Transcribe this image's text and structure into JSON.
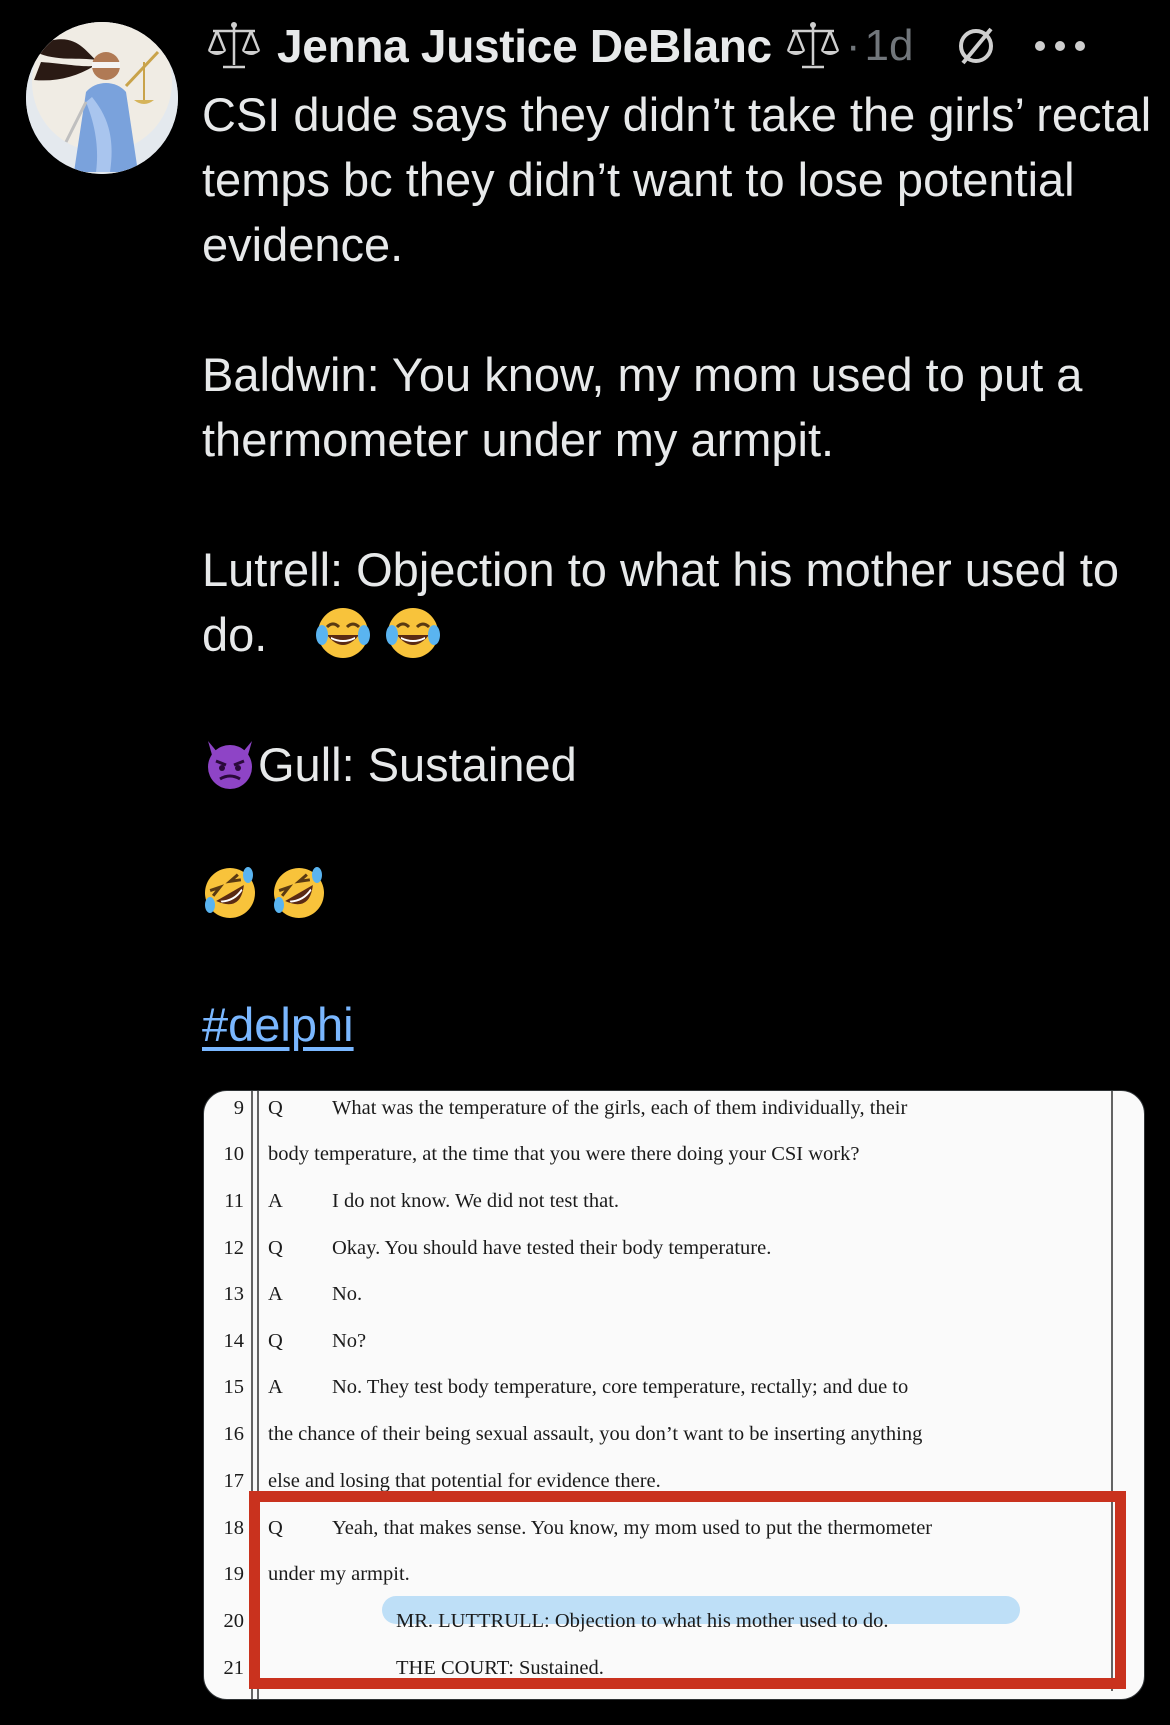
{
  "tweet": {
    "author": "Jenna Justice DeBlanc",
    "separator": "·",
    "time": "1d",
    "text": {
      "p1": "CSI dude says they didn’t take the girls’ rectal temps bc they didn’t want to lose potential evidence.",
      "p2": "Baldwin: You know, my mom used to put a thermometer under my armpit.",
      "p3": "Lutrell: Objection to what his mother used to do.",
      "p4": "Gull: Sustained",
      "hashtag": "#delphi"
    },
    "icons": {
      "left_badge": "scales-of-justice-icon",
      "right_badge": "scales-of-justice-icon",
      "muted": "muted-icon",
      "more": "more-options-icon",
      "emoji_laugh": "face-with-tears-of-joy-emoji",
      "emoji_devil": "angry-devil-emoji",
      "emoji_rofl": "rolling-on-floor-laughing-emoji"
    },
    "colors": {
      "background": "#000000",
      "text": "#e7e9ea",
      "muted": "#71767b",
      "link": "#7ab7ff",
      "highlight_border": "#c9321e"
    }
  },
  "transcript": {
    "lines": [
      {
        "num": "9",
        "qa": "Q",
        "text": "What was the temperature of the girls, each of them individually, their"
      },
      {
        "num": "10",
        "qa": "",
        "text": "body temperature, at the time that you were there doing your CSI work?"
      },
      {
        "num": "11",
        "qa": "A",
        "text": "I do not know.  We did not test that."
      },
      {
        "num": "12",
        "qa": "Q",
        "text": "Okay.  You should have tested their body temperature."
      },
      {
        "num": "13",
        "qa": "A",
        "text": "No."
      },
      {
        "num": "14",
        "qa": "Q",
        "text": "No?"
      },
      {
        "num": "15",
        "qa": "A",
        "text": "No.  They test body temperature, core temperature, rectally; and due to"
      },
      {
        "num": "16",
        "qa": "",
        "text": "the chance of their being sexual assault, you don’t want to be inserting anything"
      },
      {
        "num": "17",
        "qa": "",
        "text": "else and losing that potential for evidence there."
      },
      {
        "num": "18",
        "qa": "Q",
        "text": "Yeah, that makes sense.  You know, my mom used to put the thermometer"
      },
      {
        "num": "19",
        "qa": "",
        "text": "under my armpit."
      },
      {
        "num": "20",
        "qa": "",
        "text": "MR. LUTTRULL:   Objection to what his mother used to do."
      },
      {
        "num": "21",
        "qa": "",
        "text": "THE COURT:   Sustained."
      }
    ]
  }
}
